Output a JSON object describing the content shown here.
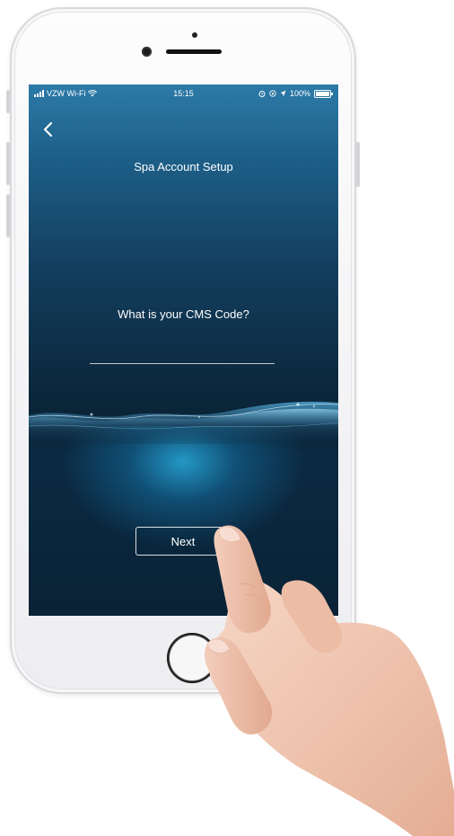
{
  "status_bar": {
    "carrier": "VZW Wi-Fi",
    "time": "15:15",
    "battery": "100%"
  },
  "header": {
    "title": "Spa Account Setup",
    "back_icon": "chevron-left-icon"
  },
  "form": {
    "question": "What is your CMS Code?",
    "cms_code_value": "",
    "cms_code_placeholder": ""
  },
  "actions": {
    "next_label": "Next"
  },
  "colors": {
    "screen_top": "#2c7aa8",
    "screen_mid": "#0c2a40",
    "water_glow": "#28aadc",
    "text": "#ffffff",
    "phone_body": "#f3f3f5",
    "skin": "#efc6b2"
  }
}
